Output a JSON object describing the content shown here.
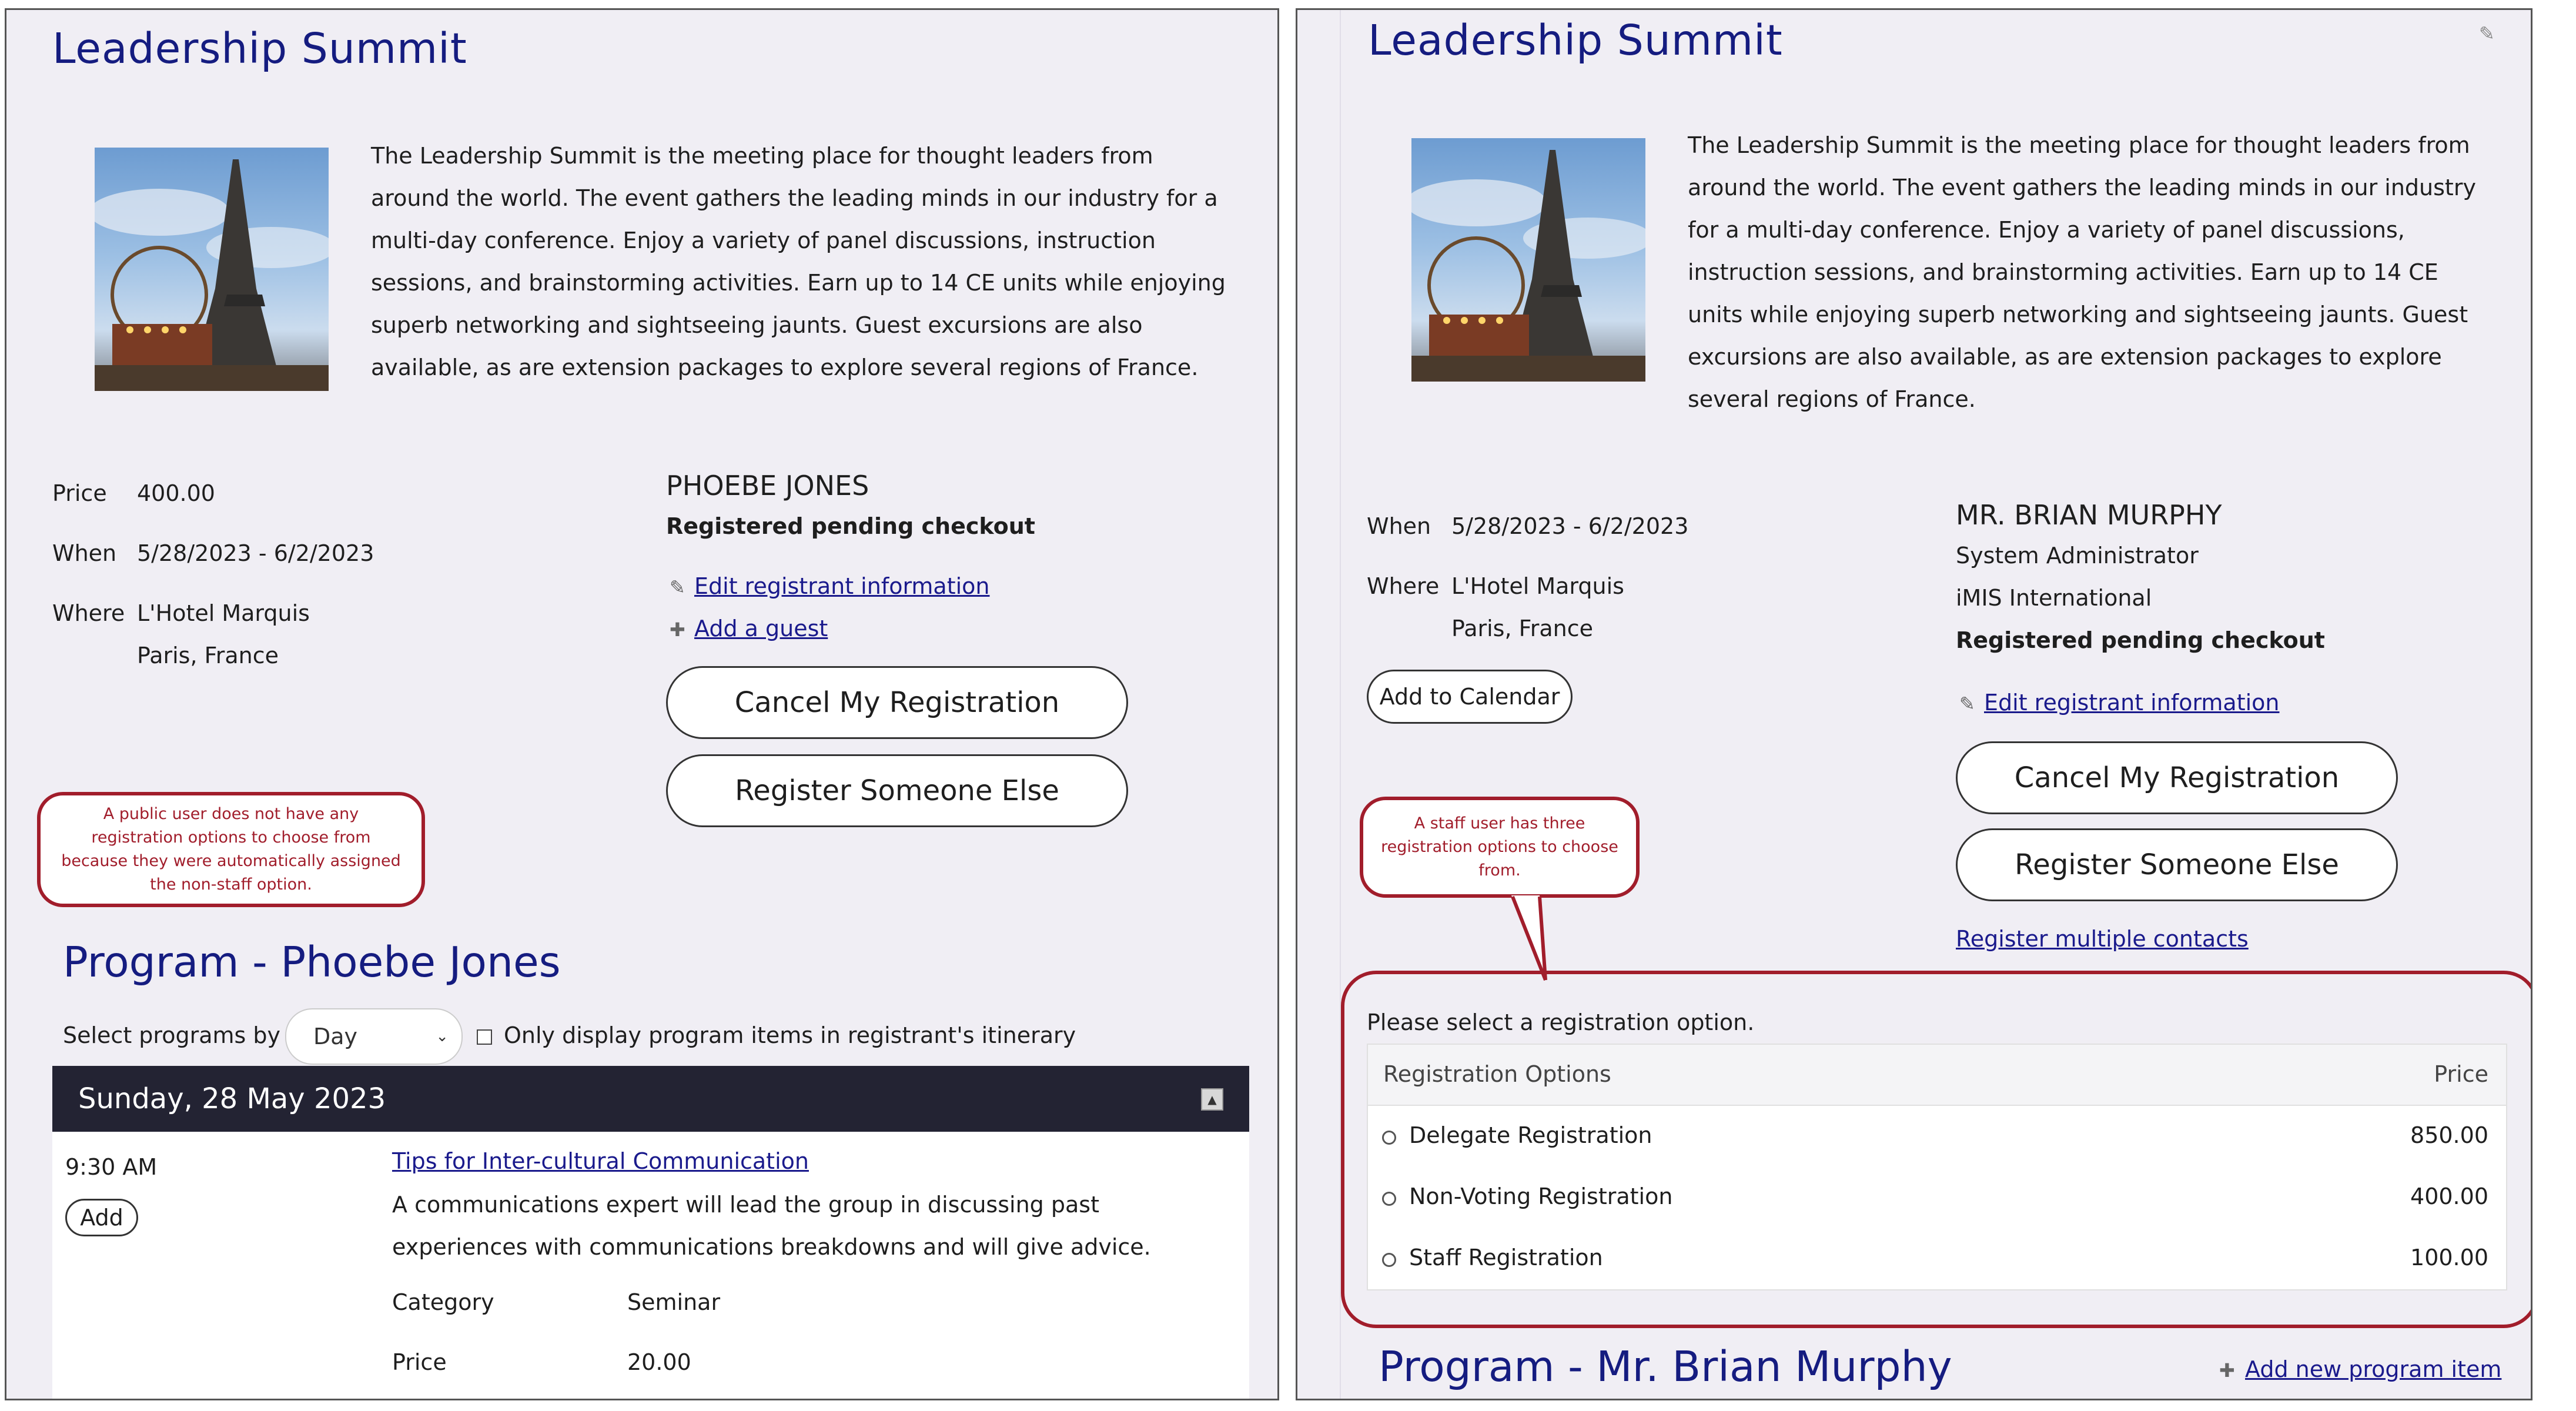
{
  "left": {
    "event_title": "Leadership Summit",
    "description": "The Leadership Summit is the meeting place for thought leaders from around the world. The event gathers the leading minds in our industry for a multi-day conference. Enjoy a variety of panel discussions, instruction sessions, and brainstorming activities. Earn up to 14 CE units while enjoying superb networking and sightseeing jaunts. Guest excursions are also available, as are extension packages to explore several regions of France.",
    "price_label": "Price",
    "price_value": "400.00",
    "when_label": "When",
    "when_value": "5/28/2023 - 6/2/2023",
    "where_label": "Where",
    "where_line1": "L'Hotel Marquis",
    "where_line2": "Paris, France",
    "registrant_name": "PHOEBE JONES",
    "registrant_status": "Registered pending checkout",
    "edit_link": "Edit registrant information",
    "add_guest_link": "Add a guest",
    "cancel_button": "Cancel My Registration",
    "register_else_button": "Register Someone Else",
    "callout_text": "A public user does not have any registration options to choose from because they were automatically assigned the non-staff option.",
    "program_title": "Program - Phoebe Jones",
    "select_by_label": "Select programs by",
    "select_by_value": "Day",
    "itinerary_label": "Only display program items in registrant's itinerary",
    "day_header": "Sunday, 28 May 2023",
    "item": {
      "time": "9:30 AM",
      "add_button": "Add",
      "title": "Tips for Inter-cultural Communication",
      "description": "A communications expert will lead the group in discussing past experiences with communications breakdowns and will give advice.",
      "category_label": "Category",
      "category_value": "Seminar",
      "price_label": "Price",
      "price_value": "20.00"
    }
  },
  "right": {
    "event_title": "Leadership Summit",
    "description": "The Leadership Summit is the meeting place for thought leaders from around the world. The event gathers the leading minds in our industry for a multi-day conference. Enjoy a variety of panel discussions, instruction sessions, and brainstorming activities. Earn up to 14 CE units while enjoying superb networking and sightseeing jaunts. Guest excursions are also available, as are extension packages to explore several regions of France.",
    "when_label": "When",
    "when_value": "5/28/2023 - 6/2/2023",
    "where_label": "Where",
    "where_line1": "L'Hotel Marquis",
    "where_line2": "Paris, France",
    "calendar_button": "Add to Calendar",
    "registrant_name": "MR. BRIAN MURPHY",
    "registrant_role": "System Administrator",
    "registrant_org": "iMIS International",
    "registrant_status": "Registered pending checkout",
    "edit_link": "Edit registrant information",
    "cancel_button": "Cancel My Registration",
    "register_else_button": "Register Someone Else",
    "register_multiple_link": "Register multiple contacts",
    "callout_text": "A staff user has three registration options to choose from.",
    "select_prompt": "Please select a registration option.",
    "options_header": "Registration Options",
    "price_header": "Price",
    "options": [
      {
        "label": "Delegate Registration",
        "price": "850.00"
      },
      {
        "label": "Non-Voting Registration",
        "price": "400.00"
      },
      {
        "label": "Staff Registration",
        "price": "100.00"
      }
    ],
    "program_title": "Program - Mr. Brian Murphy",
    "add_program_link": "Add new program item"
  },
  "icons": {
    "pencil": "✎",
    "plus": "✚",
    "chevron": "⌄",
    "collapse": "▲"
  }
}
